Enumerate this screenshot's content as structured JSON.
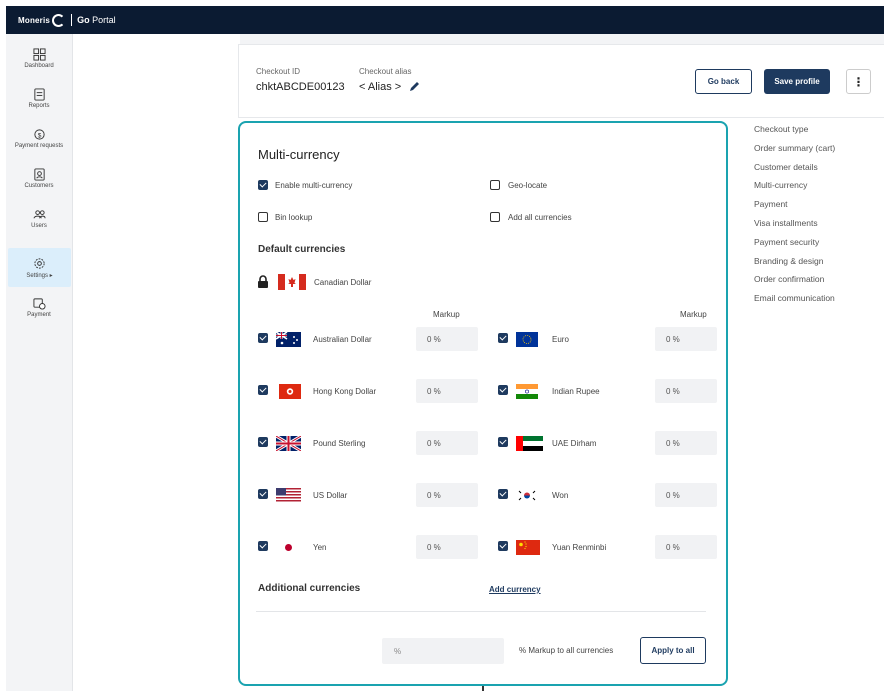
{
  "topbar": {
    "brand": "Moneris",
    "portal_prefix": "Go",
    "portal_suffix": " Portal"
  },
  "sidebar": {
    "items": [
      {
        "label": "Dashboard",
        "icon": "dashboard-icon"
      },
      {
        "label": "Reports",
        "icon": "reports-icon"
      },
      {
        "label": "Payment requests",
        "icon": "payment-requests-icon"
      },
      {
        "label": "Customers",
        "icon": "customers-icon"
      },
      {
        "label": "Users",
        "icon": "users-icon"
      },
      {
        "label": "Settings ▸",
        "icon": "settings-icon",
        "active": true
      },
      {
        "label": "Payment",
        "icon": "payment-icon"
      }
    ]
  },
  "header": {
    "checkout_id_label": "Checkout ID",
    "checkout_id": "chktABCDE00123",
    "alias_label": "Checkout alias",
    "alias_value": "< Alias >",
    "go_back": "Go back",
    "save_profile": "Save profile",
    "more": "⋮"
  },
  "panel": {
    "title": "Multi-currency",
    "options": {
      "enable_multi": {
        "label": "Enable multi-currency",
        "checked": true
      },
      "geo_locate": {
        "label": "Geo-locate",
        "checked": false
      },
      "bin_lookup": {
        "label": "Bin lookup",
        "checked": false
      },
      "add_all": {
        "label": "Add all currencies",
        "checked": false
      }
    },
    "default_heading": "Default currencies",
    "default_currency": "Canadian Dollar",
    "markup_label": "Markup",
    "left_currencies": [
      {
        "name": "Australian Dollar",
        "markup": "0 %"
      },
      {
        "name": "Hong Kong Dollar",
        "markup": "0 %"
      },
      {
        "name": "Pound Sterling",
        "markup": "0 %"
      },
      {
        "name": "US Dollar",
        "markup": "0 %"
      },
      {
        "name": "Yen",
        "markup": "0 %"
      }
    ],
    "right_currencies": [
      {
        "name": "Euro",
        "markup": "0 %"
      },
      {
        "name": "Indian Rupee",
        "markup": "0 %"
      },
      {
        "name": "UAE Dirham",
        "markup": "0 %"
      },
      {
        "name": "Won",
        "markup": "0 %"
      },
      {
        "name": "Yuan Renminbi",
        "markup": "0 %"
      }
    ],
    "additional_heading": "Additional currencies",
    "add_currency": "Add currency",
    "percent_placeholder": "%",
    "markup_all_label": "% Markup to all currencies",
    "apply_all": "Apply to all"
  },
  "menu": {
    "items": [
      "Checkout type",
      "Order summary (cart)",
      "Customer details",
      "Multi-currency",
      "Payment",
      "Visa installments",
      "Payment security",
      "Branding & design",
      "Order confirmation",
      "Email communication"
    ]
  },
  "colors": {
    "navy": "#0b1b32",
    "accent": "#1e3a5f",
    "highlight": "#1aa3b0"
  }
}
